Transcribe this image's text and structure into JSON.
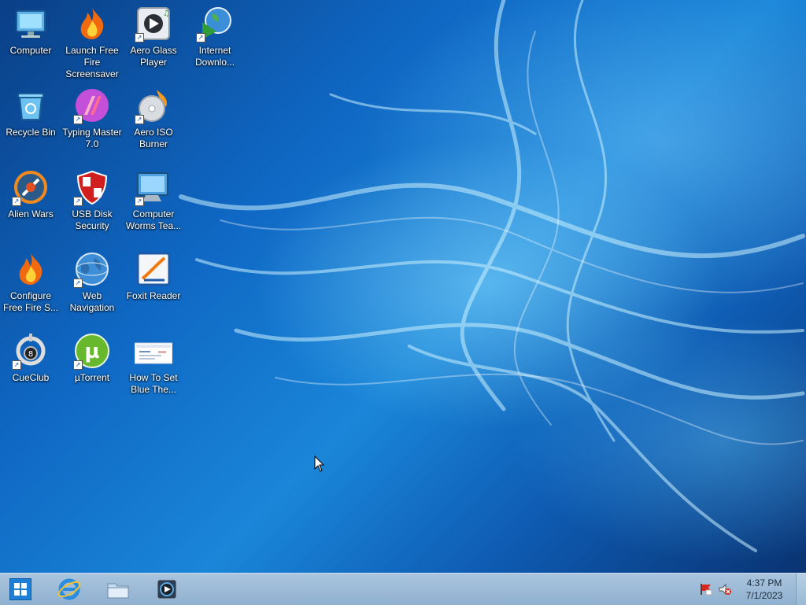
{
  "desktop": {
    "icons": [
      {
        "id": "computer",
        "label": "Computer",
        "icon": "computer-icon",
        "shortcut": false
      },
      {
        "id": "launch-free-fire",
        "label": "Launch Free Fire Screensaver",
        "icon": "flame-icon",
        "shortcut": false
      },
      {
        "id": "aero-glass-player",
        "label": "Aero Glass Player",
        "icon": "media-player-icon",
        "shortcut": true
      },
      {
        "id": "internet-download",
        "label": "Internet Downlo...",
        "icon": "download-globe-icon",
        "shortcut": true
      },
      {
        "id": "recycle-bin",
        "label": "Recycle Bin",
        "icon": "recycle-bin-icon",
        "shortcut": false
      },
      {
        "id": "typing-master",
        "label": "Typing Master 7.0",
        "icon": "typing-icon",
        "shortcut": true
      },
      {
        "id": "aero-iso-burner",
        "label": "Aero ISO Burner",
        "icon": "disc-burner-icon",
        "shortcut": true
      },
      {
        "id": "alien-wars",
        "label": "Alien Wars",
        "icon": "alien-game-icon",
        "shortcut": true
      },
      {
        "id": "usb-disk-security",
        "label": "USB Disk Security",
        "icon": "shield-icon",
        "shortcut": true
      },
      {
        "id": "computer-worms-team",
        "label": "Computer Worms Tea...",
        "icon": "monitor-icon",
        "shortcut": true
      },
      {
        "id": "configure-free-fire",
        "label": "Configure Free Fire S...",
        "icon": "flame-icon",
        "shortcut": false
      },
      {
        "id": "web-navigation",
        "label": "Web Navigation",
        "icon": "globe-icon",
        "shortcut": true
      },
      {
        "id": "foxit-reader",
        "label": "Foxit Reader",
        "icon": "pdf-reader-icon",
        "shortcut": true
      },
      {
        "id": "cueclub",
        "label": "CueClub",
        "icon": "billiard-ball-icon",
        "shortcut": true
      },
      {
        "id": "utorrent",
        "label": "µTorrent",
        "icon": "utorrent-icon",
        "shortcut": true
      },
      {
        "id": "how-to-set-blue",
        "label": "How To Set Blue The...",
        "icon": "document-thumbnail-icon",
        "shortcut": false
      }
    ]
  },
  "taskbar": {
    "start": {
      "icon": "windows-start-icon"
    },
    "pinned": [
      {
        "id": "internet-explorer",
        "icon": "internet-explorer-icon"
      },
      {
        "id": "file-explorer",
        "icon": "folder-icon"
      },
      {
        "id": "media-player",
        "icon": "media-player-icon"
      }
    ],
    "tray": {
      "icons": [
        "flag-alert-icon",
        "speaker-muted-icon"
      ],
      "time": "4:37 PM",
      "date": "7/1/2023"
    }
  },
  "colors": {
    "wallpaper_dark": "#0a3f86",
    "wallpaper_light": "#1a86d8",
    "taskbar": "#9fbbd6",
    "start_button": "#1e7fd6"
  }
}
